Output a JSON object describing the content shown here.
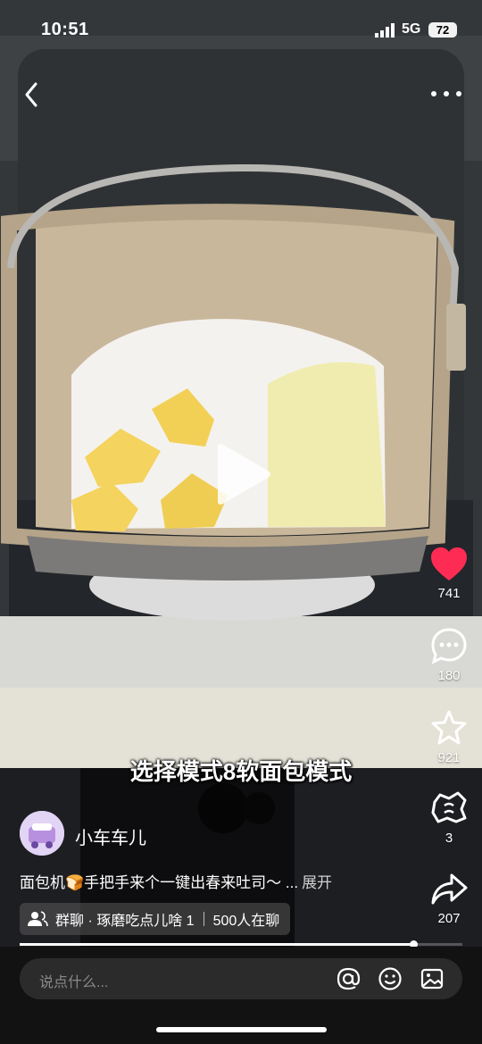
{
  "status_bar": {
    "time": "10:51",
    "network": "5G",
    "battery": "72"
  },
  "video": {
    "caption": "选择模式8软面包模式"
  },
  "actions": {
    "like_count": "741",
    "comment_count": "180",
    "favorite_count": "921",
    "share_alt_count": "3",
    "share_count": "207"
  },
  "post": {
    "author": "小车车儿",
    "description": "面包机🍞手把手来个一键出春来吐司～ ...",
    "expand_label": "展开",
    "group_name": "群聊 · 琢磨吃点儿啥 1",
    "group_online": "500人在聊"
  },
  "progress": {
    "fraction": 0.89
  },
  "comment_bar": {
    "placeholder": "说点什么..."
  },
  "colors": {
    "like": "#fe2c55",
    "background": "#000000"
  },
  "icons": [
    "back-icon",
    "more-icon",
    "play-icon",
    "heart-icon",
    "comment-icon",
    "star-icon",
    "dumpling-icon",
    "share-icon",
    "group-icon",
    "at-icon",
    "emoji-icon",
    "image-icon"
  ]
}
